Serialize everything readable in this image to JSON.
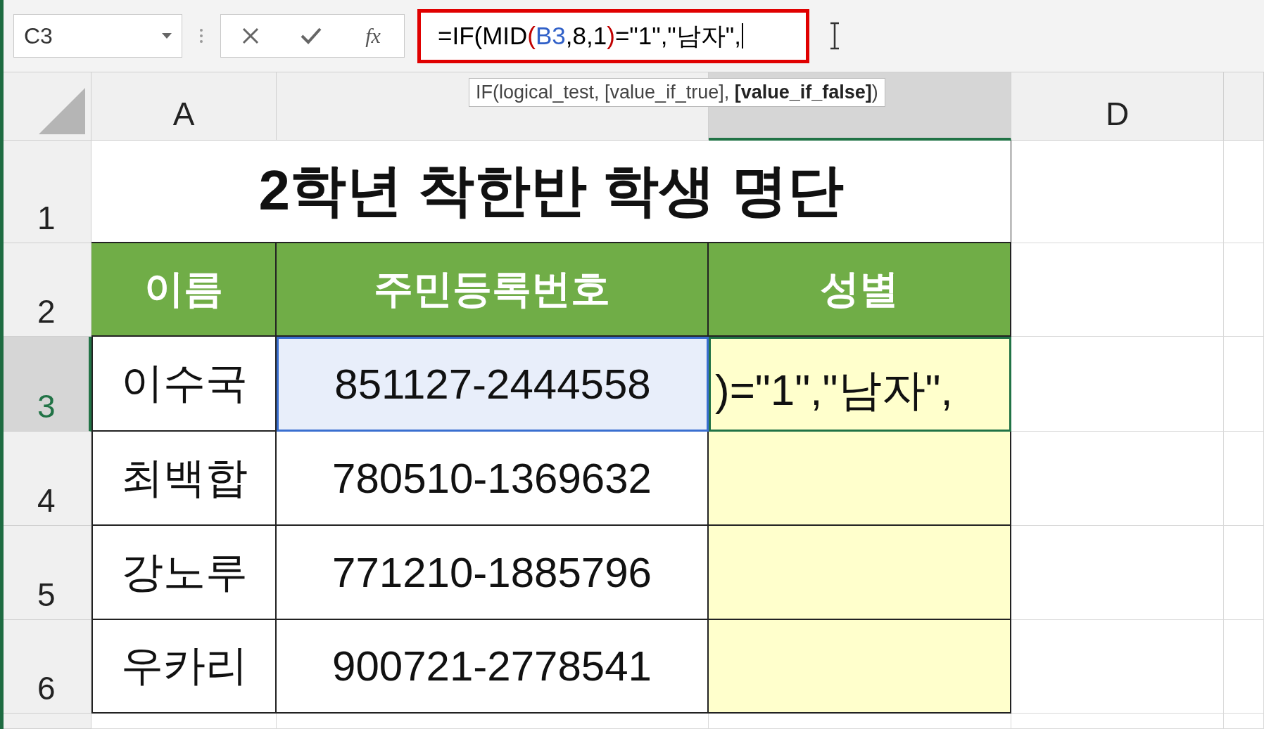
{
  "name_box": {
    "value": "C3"
  },
  "formula_bar": {
    "function_button": "fx",
    "segments": [
      {
        "text": "=IF(MID",
        "color": "#000000"
      },
      {
        "text": "(",
        "color": "#c00000"
      },
      {
        "text": "B3",
        "color": "#3060c8"
      },
      {
        "text": ",8,1",
        "color": "#000000"
      },
      {
        "text": ")",
        "color": "#c00000"
      },
      {
        "text": "=\"1\",\"남자\",",
        "color": "#000000"
      }
    ]
  },
  "tooltip": "IF(logical_test, [value_if_true], **[value_if_false]**)",
  "columns": [
    {
      "label": "A",
      "selected": false
    },
    {
      "selected": false
    },
    {
      "selected": true
    },
    {
      "label": "D",
      "selected": false
    }
  ],
  "rows": [
    {
      "header": "1",
      "selected": false,
      "title": "2학년 착한반 학생 명단"
    },
    {
      "header": "2",
      "selected": false,
      "cells": [
        {
          "kind": "header",
          "text": "이름"
        },
        {
          "kind": "header",
          "text": "주민등록번호"
        },
        {
          "kind": "header",
          "text": "성별"
        }
      ]
    },
    {
      "header": "3",
      "selected": true,
      "cells": [
        {
          "kind": "name",
          "text": "이수국"
        },
        {
          "kind": "id",
          "text": "851127-2444558",
          "referenced": true
        },
        {
          "kind": "input",
          "editing": true,
          "lines": [
            ")=\"1\",\"남자\","
          ]
        }
      ]
    },
    {
      "header": "4",
      "selected": false,
      "cells": [
        {
          "kind": "name",
          "text": "최백합"
        },
        {
          "kind": "id",
          "text": "780510-1369632"
        },
        {
          "kind": "input"
        }
      ]
    },
    {
      "header": "5",
      "selected": false,
      "cells": [
        {
          "kind": "name",
          "text": "강노루"
        },
        {
          "kind": "id",
          "text": "771210-1885796"
        },
        {
          "kind": "input"
        }
      ]
    },
    {
      "header": "6",
      "selected": false,
      "cells": [
        {
          "kind": "name",
          "text": "우카리"
        },
        {
          "kind": "id",
          "text": "900721-2778541"
        },
        {
          "kind": "input"
        }
      ]
    }
  ]
}
